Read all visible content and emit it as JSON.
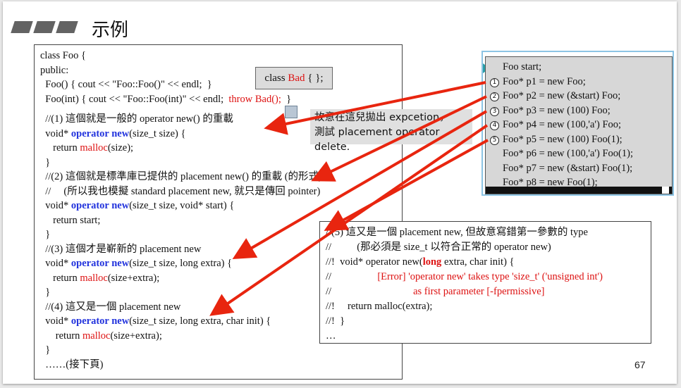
{
  "title": "示例",
  "class_bad": {
    "prefix": "class ",
    "name": "Bad",
    "suffix": " { };"
  },
  "note": {
    "line1": "故意在這兒拋出 expcetion，",
    "line2": "測試 placement operator delete."
  },
  "code": {
    "l1": "class Foo {",
    "l2": "public:",
    "l3": "  Foo() { cout << \"Foo::Foo()\" << endl;  }",
    "l4a": "  Foo(int) { cout << \"Foo::Foo(int)\" << endl;  ",
    "l4b": "throw Bad();",
    "l4c": "  }",
    "l5": "  //(1) 這個就是一般的 operator new() 的重載",
    "l6a": "  void* ",
    "l6b": "operator new",
    "l6c": "(size_t size) {",
    "l7a": "     return ",
    "l7b": "malloc",
    "l7c": "(size);",
    "l8": "  }",
    "l9": "  //(2) 這個就是標準庫已提供的 placement new() 的重載 (的形式)",
    "l10": "  //     (所以我也模擬 standard placement new, 就只是傳回 pointer)",
    "l11a": "  void* ",
    "l11b": "operator new",
    "l11c": "(size_t size, void* start) {",
    "l12": "     return start;",
    "l13": "  }",
    "l14": "  //(3) 這個才是嶄新的 placement new",
    "l15a": "  void* ",
    "l15b": "operator new",
    "l15c": "(size_t size, long extra) {",
    "l16a": "     return ",
    "l16b": "malloc",
    "l16c": "(size+extra);",
    "l17": "  }",
    "l18": "  //(4) 這又是一個 placement new",
    "l19a": "  void* ",
    "l19b": "operator new",
    "l19c": "(size_t size, long extra, char init) {",
    "l20a": "      return ",
    "l20b": "malloc",
    "l20c": "(size+extra);",
    "l21": "  }",
    "l22": "  ……(接下頁)"
  },
  "comment": {
    "c1": "//(5) 這又是一個 placement new, 但故意寫錯第一參數的 type",
    "c2": "//          (那必須是 size_t 以符合正常的 operator new)",
    "c3a": "//!  void* operator new(",
    "c3b": "long",
    "c3c": " extra, char init) {",
    "c4a": "//                  ",
    "c4b": "[Error] 'operator new' takes type 'size_t' ('unsigned int')",
    "c5a": "//                                ",
    "c5b": "as first parameter [-fpermissive]",
    "c6": "//!     return malloc(extra);",
    "c7": "//!  }",
    "c8": "…"
  },
  "output": {
    "lines": [
      "Foo start;",
      "Foo* p1 = new Foo;",
      "Foo* p2 = new (&start) Foo;",
      "Foo* p3 = new (100) Foo;",
      "Foo* p4 = new (100,'a') Foo;",
      "Foo* p5 = new (100) Foo(1);",
      "Foo* p6 = new (100,'a') Foo(1);",
      "Foo* p7 = new (&start) Foo(1);",
      "Foo* p8 = new Foo(1);"
    ],
    "markers": [
      "1",
      "2",
      "3",
      "4",
      "5"
    ]
  },
  "page_number": "67",
  "colors": {
    "keyword": "#2233dd",
    "highlight": "#dd1111",
    "arrow": "#e8250f"
  }
}
